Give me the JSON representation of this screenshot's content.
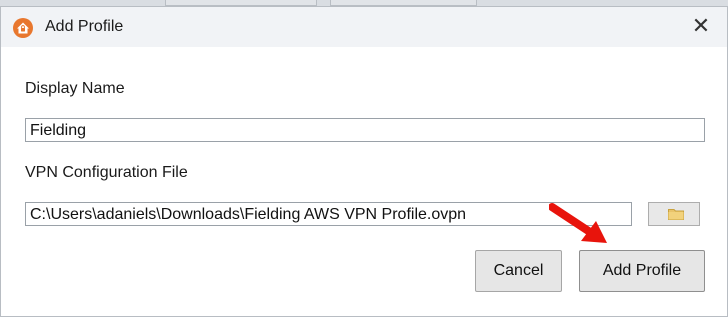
{
  "dialog": {
    "title": "Add Profile",
    "close_glyph": "✕",
    "app_icon": "home-lock-icon"
  },
  "form": {
    "display_name_label": "Display Name",
    "display_name_value": "Fielding",
    "vpn_file_label": "VPN Configuration File",
    "vpn_file_value": "C:\\Users\\adaniels\\Downloads\\Fielding AWS VPN Profile.ovpn",
    "browse_icon": "folder-icon"
  },
  "buttons": {
    "cancel_label": "Cancel",
    "add_label": "Add Profile"
  },
  "annotation": {
    "arrow_color": "#e8140c",
    "icon_color": "#e8772e"
  }
}
